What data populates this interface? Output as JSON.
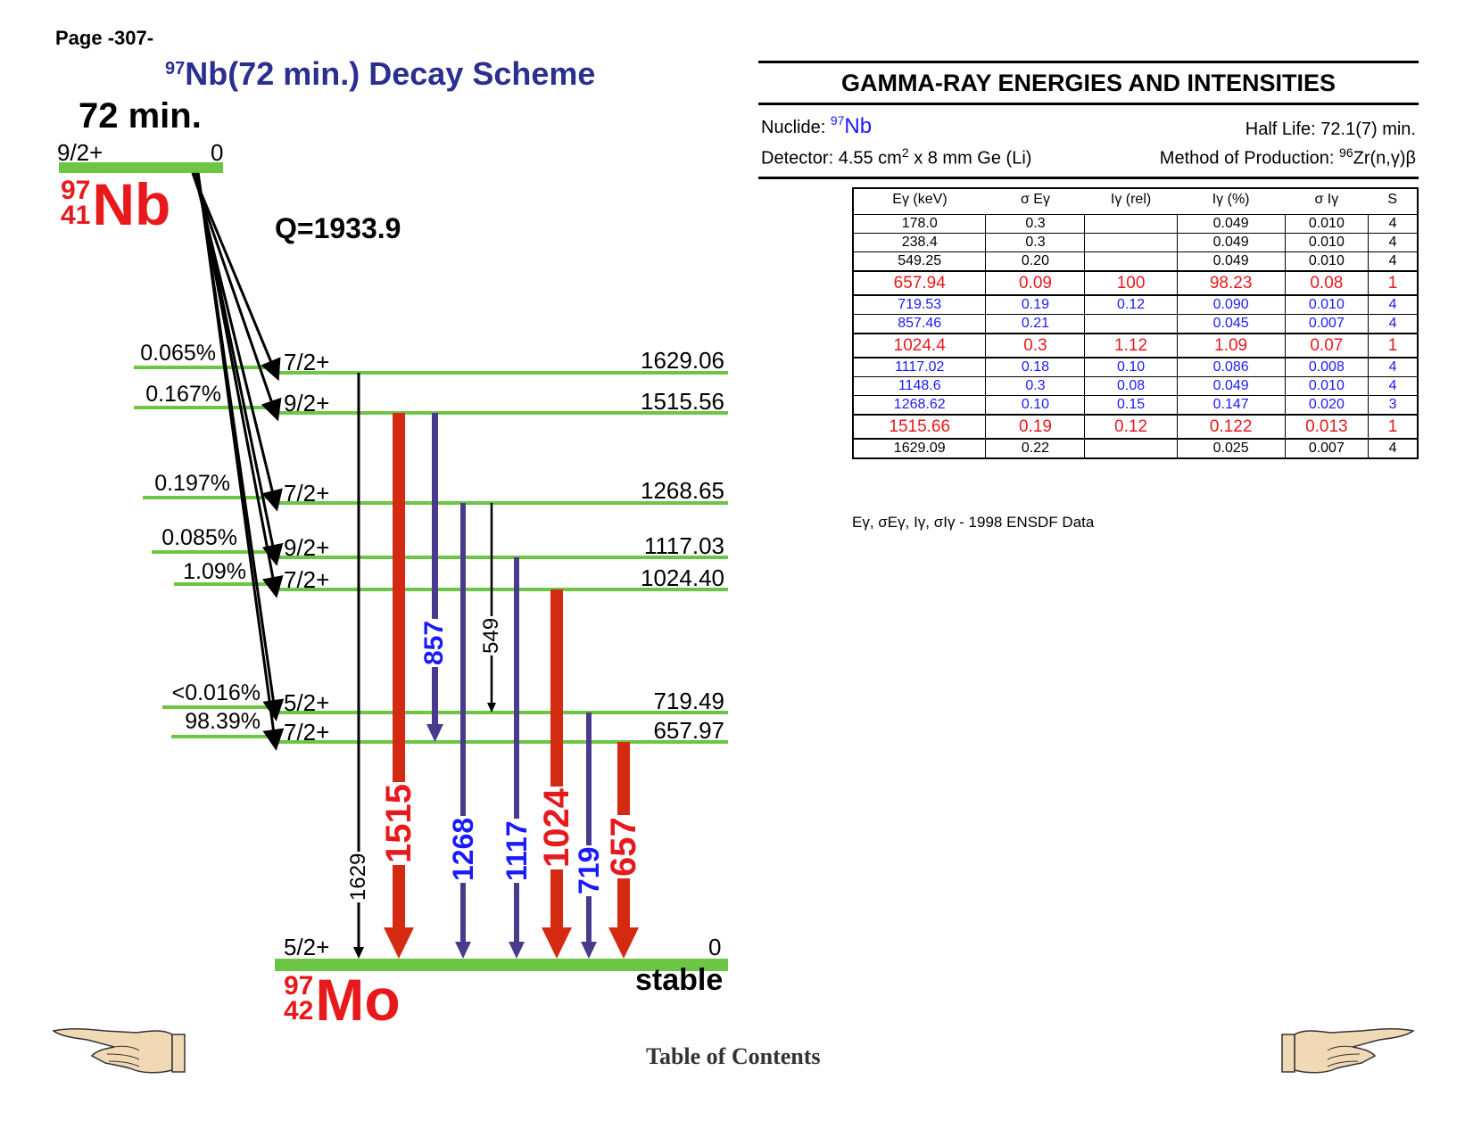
{
  "header": {
    "page_number": "Page -307-",
    "title_mass": "97",
    "title_text": "Nb(72 min.) Decay Scheme"
  },
  "diagram": {
    "parent": {
      "half_life": "72 min.",
      "spin": "9/2+",
      "energy": "0",
      "mass": "97",
      "z": "41",
      "symbol": "Nb"
    },
    "q_value": "Q=1933.9",
    "daughter": {
      "mass": "97",
      "z": "42",
      "symbol": "Mo",
      "spin": "5/2+",
      "energy": "0",
      "status": "stable"
    },
    "levels": [
      {
        "spin": "7/2+",
        "energy": "1629.06",
        "beta": "0.065%"
      },
      {
        "spin": "9/2+",
        "energy": "1515.56",
        "beta": "0.167%"
      },
      {
        "spin": "7/2+",
        "energy": "1268.65",
        "beta": "0.197%"
      },
      {
        "spin": "9/2+",
        "energy": "1117.03",
        "beta": "0.085%"
      },
      {
        "spin": "7/2+",
        "energy": "1024.40",
        "beta": "1.09%"
      },
      {
        "spin": "5/2+",
        "energy": "719.49",
        "beta": "<0.016%"
      },
      {
        "spin": "7/2+",
        "energy": "657.97",
        "beta": "98.39%"
      }
    ],
    "gammas": [
      {
        "label": "1629",
        "color": "#000000"
      },
      {
        "label": "1515",
        "color": "#e8191c"
      },
      {
        "label": "857",
        "color": "#1a1aff"
      },
      {
        "label": "1268",
        "color": "#1a1aff"
      },
      {
        "label": "549",
        "color": "#000000"
      },
      {
        "label": "1117",
        "color": "#1a1aff"
      },
      {
        "label": "1024",
        "color": "#e8191c"
      },
      {
        "label": "719",
        "color": "#1a1aff"
      },
      {
        "label": "657",
        "color": "#e8191c"
      }
    ],
    "colors": {
      "level_line": "#6cc644",
      "strong_arrow": "#d42a12",
      "weak_arrow": "#4a3a8c",
      "nuclide_red": "#e8191c"
    }
  },
  "gamma_table": {
    "title": "GAMMA-RAY ENERGIES AND INTENSITIES",
    "nuclide_label": "Nuclide: ",
    "nuclide_mass": "97",
    "nuclide_symbol": "Nb",
    "half_life": "Half Life: 72.1(7) min.",
    "detector": "Detector: 4.55 cm",
    "detector_sup": "2",
    "detector_rest": " x 8 mm Ge (Li)",
    "production_label": "Method of Production: ",
    "production_sup": "96",
    "production_rest": "Zr(n,γ)β",
    "columns": [
      "Eγ (keV)",
      "σ Eγ",
      "Iγ (rel)",
      "Iγ (%)",
      "σ Iγ",
      "S"
    ],
    "rows": [
      {
        "style": "black",
        "cells": [
          "178.0",
          "0.3",
          "",
          "0.049",
          "0.010",
          "4"
        ]
      },
      {
        "style": "black",
        "cells": [
          "238.4",
          "0.3",
          "",
          "0.049",
          "0.010",
          "4"
        ]
      },
      {
        "style": "black",
        "cells": [
          "549.25",
          "0.20",
          "",
          "0.049",
          "0.010",
          "4"
        ]
      },
      {
        "style": "red",
        "cells": [
          "657.94",
          "0.09",
          "100",
          "98.23",
          "0.08",
          "1"
        ]
      },
      {
        "style": "blue",
        "cells": [
          "719.53",
          "0.19",
          "0.12",
          "0.090",
          "0.010",
          "4"
        ]
      },
      {
        "style": "blue",
        "cells": [
          "857.46",
          "0.21",
          "",
          "0.045",
          "0.007",
          "4"
        ]
      },
      {
        "style": "red",
        "cells": [
          "1024.4",
          "0.3",
          "1.12",
          "1.09",
          "0.07",
          "1"
        ]
      },
      {
        "style": "blue",
        "cells": [
          "1117.02",
          "0.18",
          "0.10",
          "0.086",
          "0.008",
          "4"
        ]
      },
      {
        "style": "blue",
        "cells": [
          "1148.6",
          "0.3",
          "0.08",
          "0.049",
          "0.010",
          "4"
        ]
      },
      {
        "style": "blue",
        "cells": [
          "1268.62",
          "0.10",
          "0.15",
          "0.147",
          "0.020",
          "3"
        ]
      },
      {
        "style": "red",
        "cells": [
          "1515.66",
          "0.19",
          "0.12",
          "0.122",
          "0.013",
          "1"
        ]
      },
      {
        "style": "black",
        "cells": [
          "1629.09",
          "0.22",
          "",
          "0.025",
          "0.007",
          "4"
        ]
      }
    ],
    "footnote": "Eγ, σEγ, Iγ, σIγ - 1998 ENSDF Data"
  },
  "footer": {
    "toc_label": "Table of Contents",
    "prev_icon": "pointing-hand-left-icon",
    "next_icon": "pointing-hand-right-icon"
  }
}
